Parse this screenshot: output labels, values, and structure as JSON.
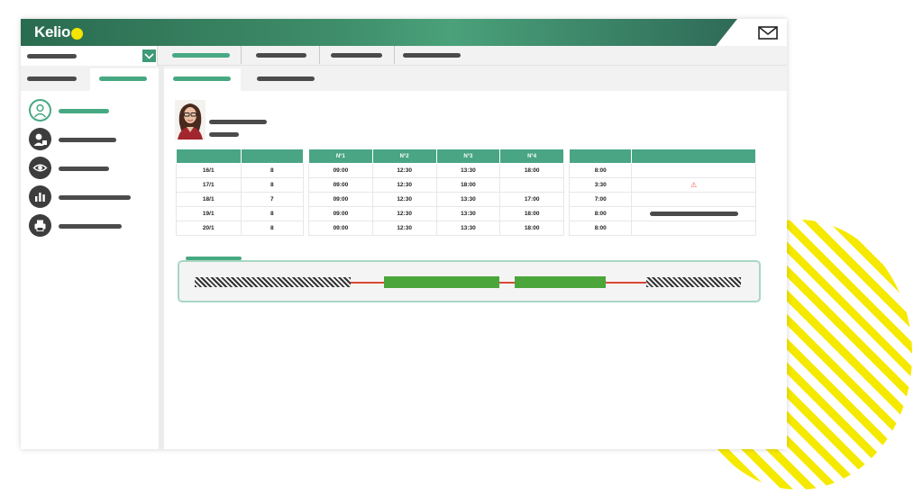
{
  "app": {
    "logo_text": "Kelio",
    "brand_color": "#3f8e6b",
    "accent_color": "#f4e400"
  },
  "header": {
    "mail_icon": "mail-icon"
  },
  "sidebar": {
    "items": [
      {
        "icon": "user-profile-icon",
        "active": true
      },
      {
        "icon": "user-team-icon",
        "active": false
      },
      {
        "icon": "eye-icon",
        "active": false
      },
      {
        "icon": "bar-chart-icon",
        "active": false
      },
      {
        "icon": "printer-icon",
        "active": false
      }
    ]
  },
  "timesheet": {
    "punch_headers": [
      "N°1",
      "N°2",
      "N°3",
      "N°4"
    ],
    "rows": [
      {
        "date": "16/1",
        "value": "8",
        "punches": [
          "09:00",
          "12:30",
          "13:30",
          "18:00"
        ],
        "total": "8:00",
        "flag": ""
      },
      {
        "date": "17/1",
        "value": "8",
        "punches": [
          "09:00",
          "12:30",
          "18:00",
          ""
        ],
        "total": "3:30",
        "flag": "⚠"
      },
      {
        "date": "18/1",
        "value": "7",
        "punches": [
          "09:00",
          "12:30",
          "13:30",
          "17:00"
        ],
        "total": "7:00",
        "flag": ""
      },
      {
        "date": "19/1",
        "value": "8",
        "punches": [
          "09:00",
          "12:30",
          "13:30",
          "18:00"
        ],
        "total": "8:00",
        "flag": "comment"
      },
      {
        "date": "20/1",
        "value": "8",
        "punches": [
          "09:00",
          "12:30",
          "13:30",
          "18:00"
        ],
        "total": "8:00",
        "flag": ""
      }
    ]
  },
  "colors": {
    "table_header": "#4aa584",
    "work_block": "#4aa63a",
    "break_line": "#d94836",
    "warning": "#e35b4b"
  }
}
